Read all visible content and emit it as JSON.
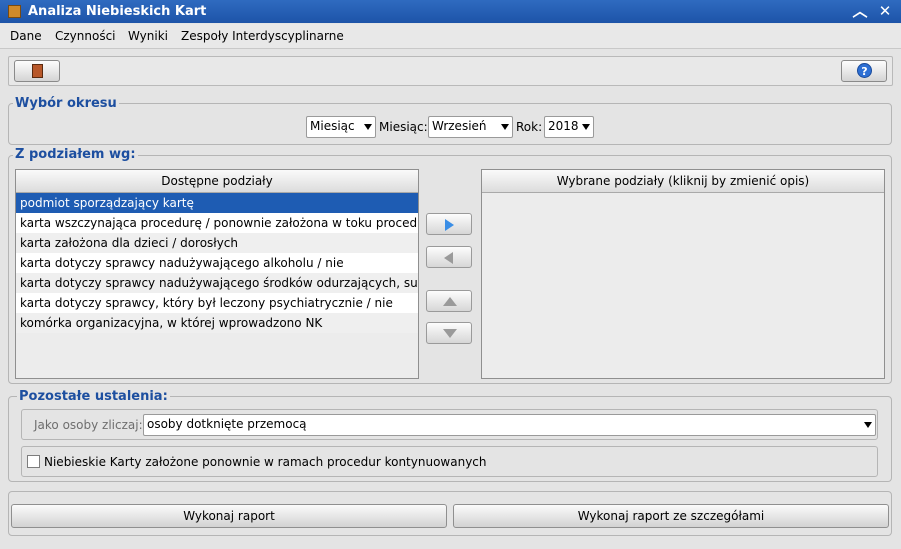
{
  "window": {
    "title": "Analiza Niebieskich Kart",
    "minimize_glyph": "︿",
    "close_glyph": "✕"
  },
  "menu": [
    "Dane",
    "Czynności",
    "Wyniki",
    "Zespoły Interdyscyplinarne"
  ],
  "toolbar": {
    "exit_icon": "door-exit-icon",
    "help_icon": "help-icon"
  },
  "period": {
    "title": "Wybór okresu",
    "type_value": "Miesiąc",
    "month_label": "Miesiąc:",
    "month_value": "Wrzesień",
    "year_label": "Rok:",
    "year_value": "2018"
  },
  "split": {
    "title": "Z podziałem wg:",
    "available_header": "Dostępne podziały",
    "selected_header": "Wybrane podziały (kliknij by zmienić opis)",
    "available_items": [
      "podmiot sporządzający kartę",
      "karta wszczynająca procedurę / ponownie założona w toku proced...",
      "karta założona dla dzieci / dorosłych",
      "karta dotyczy sprawcy nadużywającego alkoholu / nie",
      "karta dotyczy sprawcy nadużywającego środków odurzających, su...",
      "karta dotyczy sprawcy, który był leczony psychiatrycznie / nie",
      "komórka organizacyjna, w której wprowadzono NK"
    ],
    "selected_index": 0
  },
  "other": {
    "title": "Pozostałe ustalenia:",
    "count_as_label": "Jako osoby zliczaj:",
    "count_as_value": "osoby dotknięte przemocą",
    "continued_checkbox_label": "Niebieskie Karty założone ponownie w ramach procedur kontynuowanych",
    "continued_checked": false
  },
  "actions": {
    "run_report": "Wykonaj raport",
    "run_report_details": "Wykonaj raport ze szczegółami"
  },
  "colors": {
    "title_bar": "#1d54a8",
    "group_title": "#1d4fa0",
    "selection": "#1e5cb3"
  }
}
